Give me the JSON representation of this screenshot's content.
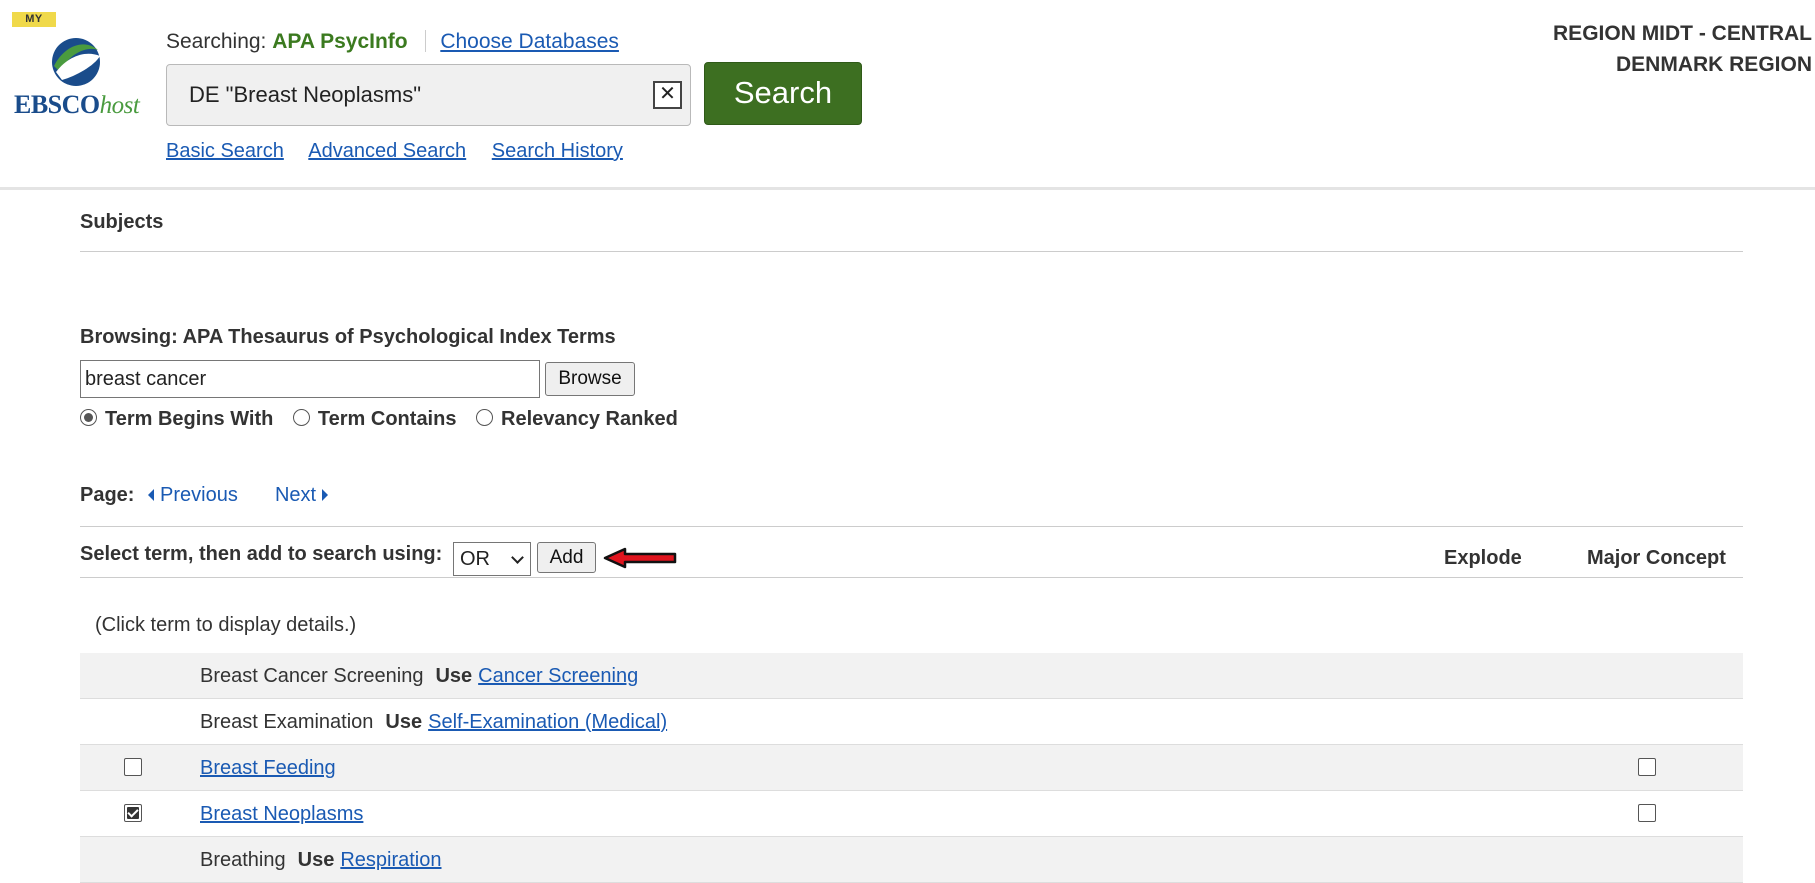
{
  "header": {
    "logo_badge": "MY",
    "logo_main": "EBSCO",
    "logo_host": "host",
    "searching_label": "Searching:",
    "database_name": "APA PsycInfo",
    "choose_databases": "Choose Databases",
    "search_value": "DE \"Breast Neoplasms\"",
    "search_button": "Search",
    "links": {
      "basic": "Basic Search",
      "advanced": "Advanced Search",
      "history": "Search History"
    },
    "region_line1": "REGION MIDT - CENTRAL",
    "region_line2": "DENMARK REGION"
  },
  "subjects": {
    "title": "Subjects",
    "browsing_label": "Browsing: APA Thesaurus of Psychological Index Terms",
    "browse_value": "breast cancer",
    "browse_button": "Browse",
    "radio_options": [
      {
        "label": "Term Begins With",
        "checked": true
      },
      {
        "label": "Term Contains",
        "checked": false
      },
      {
        "label": "Relevancy Ranked",
        "checked": false
      }
    ],
    "page_label": "Page:",
    "previous": "Previous",
    "next": "Next",
    "select_label": "Select term, then add to search using:",
    "operator": "OR",
    "add_button": "Add",
    "col_explode": "Explode",
    "col_major": "Major Concept",
    "click_hint": "(Click term to display details.)",
    "use_label": "Use",
    "rows": [
      {
        "term": "Breast Cancer Screening",
        "use": "Cancer Screening"
      },
      {
        "term": "Breast Examination",
        "use": "Self-Examination (Medical)"
      },
      {
        "term": "Breast Feeding",
        "explode_checked": false,
        "major_checked": false
      },
      {
        "term": "Breast Neoplasms",
        "explode_checked": true,
        "major_checked": false
      },
      {
        "term": "Breathing",
        "use": "Respiration"
      }
    ]
  },
  "colors": {
    "search_button": "#3d6f21",
    "database_name": "#3b7a1f",
    "link": "#1a5ab3",
    "arrow": "#e0141e"
  }
}
